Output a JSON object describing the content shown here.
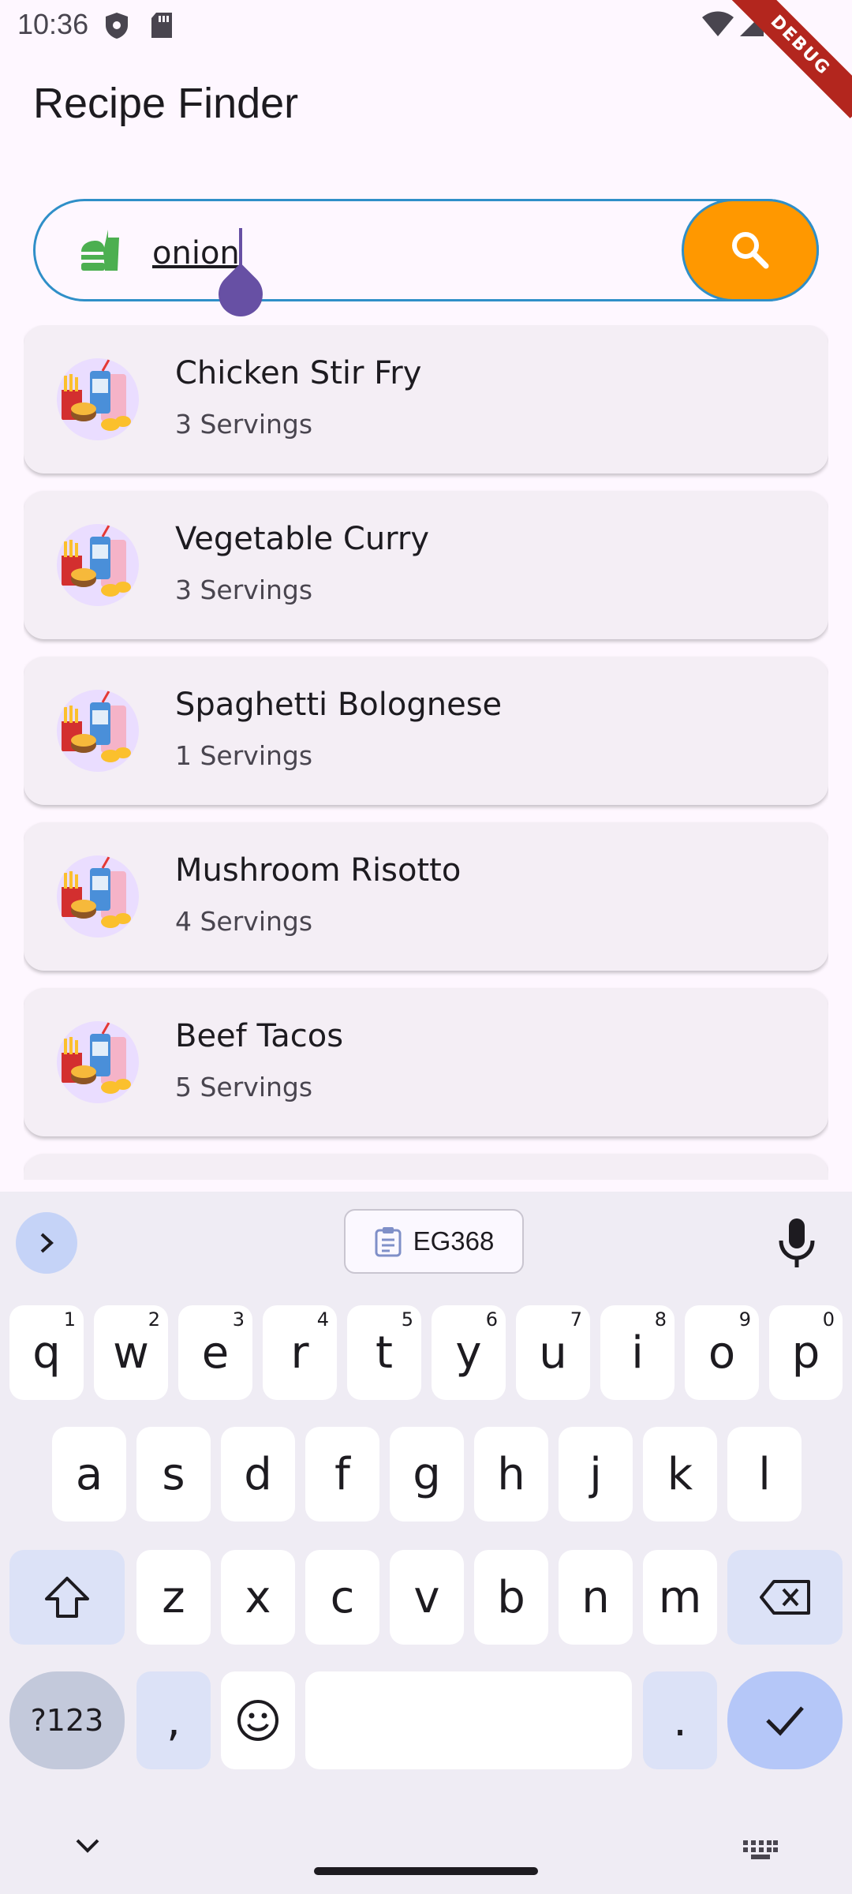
{
  "status_bar": {
    "time": "10:36",
    "debug_label": "DEBUG"
  },
  "app": {
    "title": "Recipe Finder"
  },
  "search": {
    "value": "onion",
    "placeholder": ""
  },
  "recipes": [
    {
      "name": "Chicken Stir Fry",
      "servings": "3 Servings"
    },
    {
      "name": "Vegetable Curry",
      "servings": "3 Servings"
    },
    {
      "name": "Spaghetti Bolognese",
      "servings": "1 Servings"
    },
    {
      "name": "Mushroom Risotto",
      "servings": "4 Servings"
    },
    {
      "name": "Beef Tacos",
      "servings": "5 Servings"
    }
  ],
  "keyboard": {
    "clipboard_chip": "EG368",
    "row1": [
      {
        "key": "q",
        "hint": "1"
      },
      {
        "key": "w",
        "hint": "2"
      },
      {
        "key": "e",
        "hint": "3"
      },
      {
        "key": "r",
        "hint": "4"
      },
      {
        "key": "t",
        "hint": "5"
      },
      {
        "key": "y",
        "hint": "6"
      },
      {
        "key": "u",
        "hint": "7"
      },
      {
        "key": "i",
        "hint": "8"
      },
      {
        "key": "o",
        "hint": "9"
      },
      {
        "key": "p",
        "hint": "0"
      }
    ],
    "row2": [
      "a",
      "s",
      "d",
      "f",
      "g",
      "h",
      "j",
      "k",
      "l"
    ],
    "row3": [
      "z",
      "x",
      "c",
      "v",
      "b",
      "n",
      "m"
    ],
    "symbols_label": "?123",
    "comma": ",",
    "period": "."
  },
  "colors": {
    "accent_orange": "#FF9800",
    "search_border": "#2F8FC8",
    "cursor": "#6750A4",
    "debug_ribbon": "#B3261E"
  }
}
